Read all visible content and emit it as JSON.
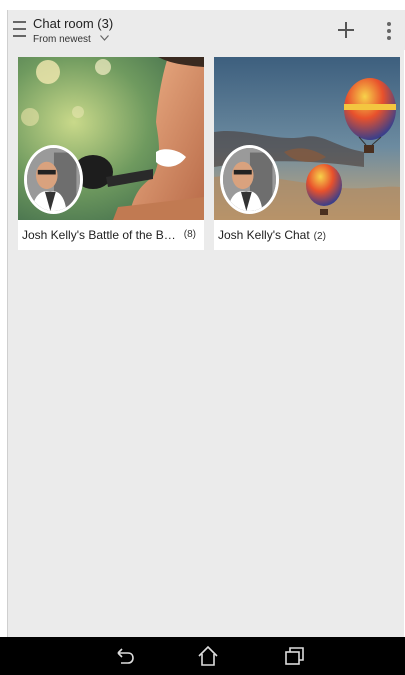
{
  "header": {
    "title": "Chat room (3)",
    "sort_label": "From newest",
    "icons": {
      "menu": "hamburger-icon",
      "sort": "chevron-down-icon",
      "add": "plus-icon",
      "more": "more-vert-icon"
    }
  },
  "cards": [
    {
      "name": "Josh Kelly's Battle of the B…",
      "count": "(8)",
      "cover": "singer-photo",
      "avatar": "profile-photo"
    },
    {
      "name": "Josh Kelly's Chat",
      "count": "(2)",
      "cover": "balloons-photo",
      "avatar": "profile-photo"
    }
  ],
  "navbar": {
    "icons": [
      "back-icon",
      "home-icon",
      "recent-apps-icon"
    ]
  },
  "colors": {
    "background": "#ebebeb",
    "card": "#ffffff",
    "navbar": "#000000"
  }
}
